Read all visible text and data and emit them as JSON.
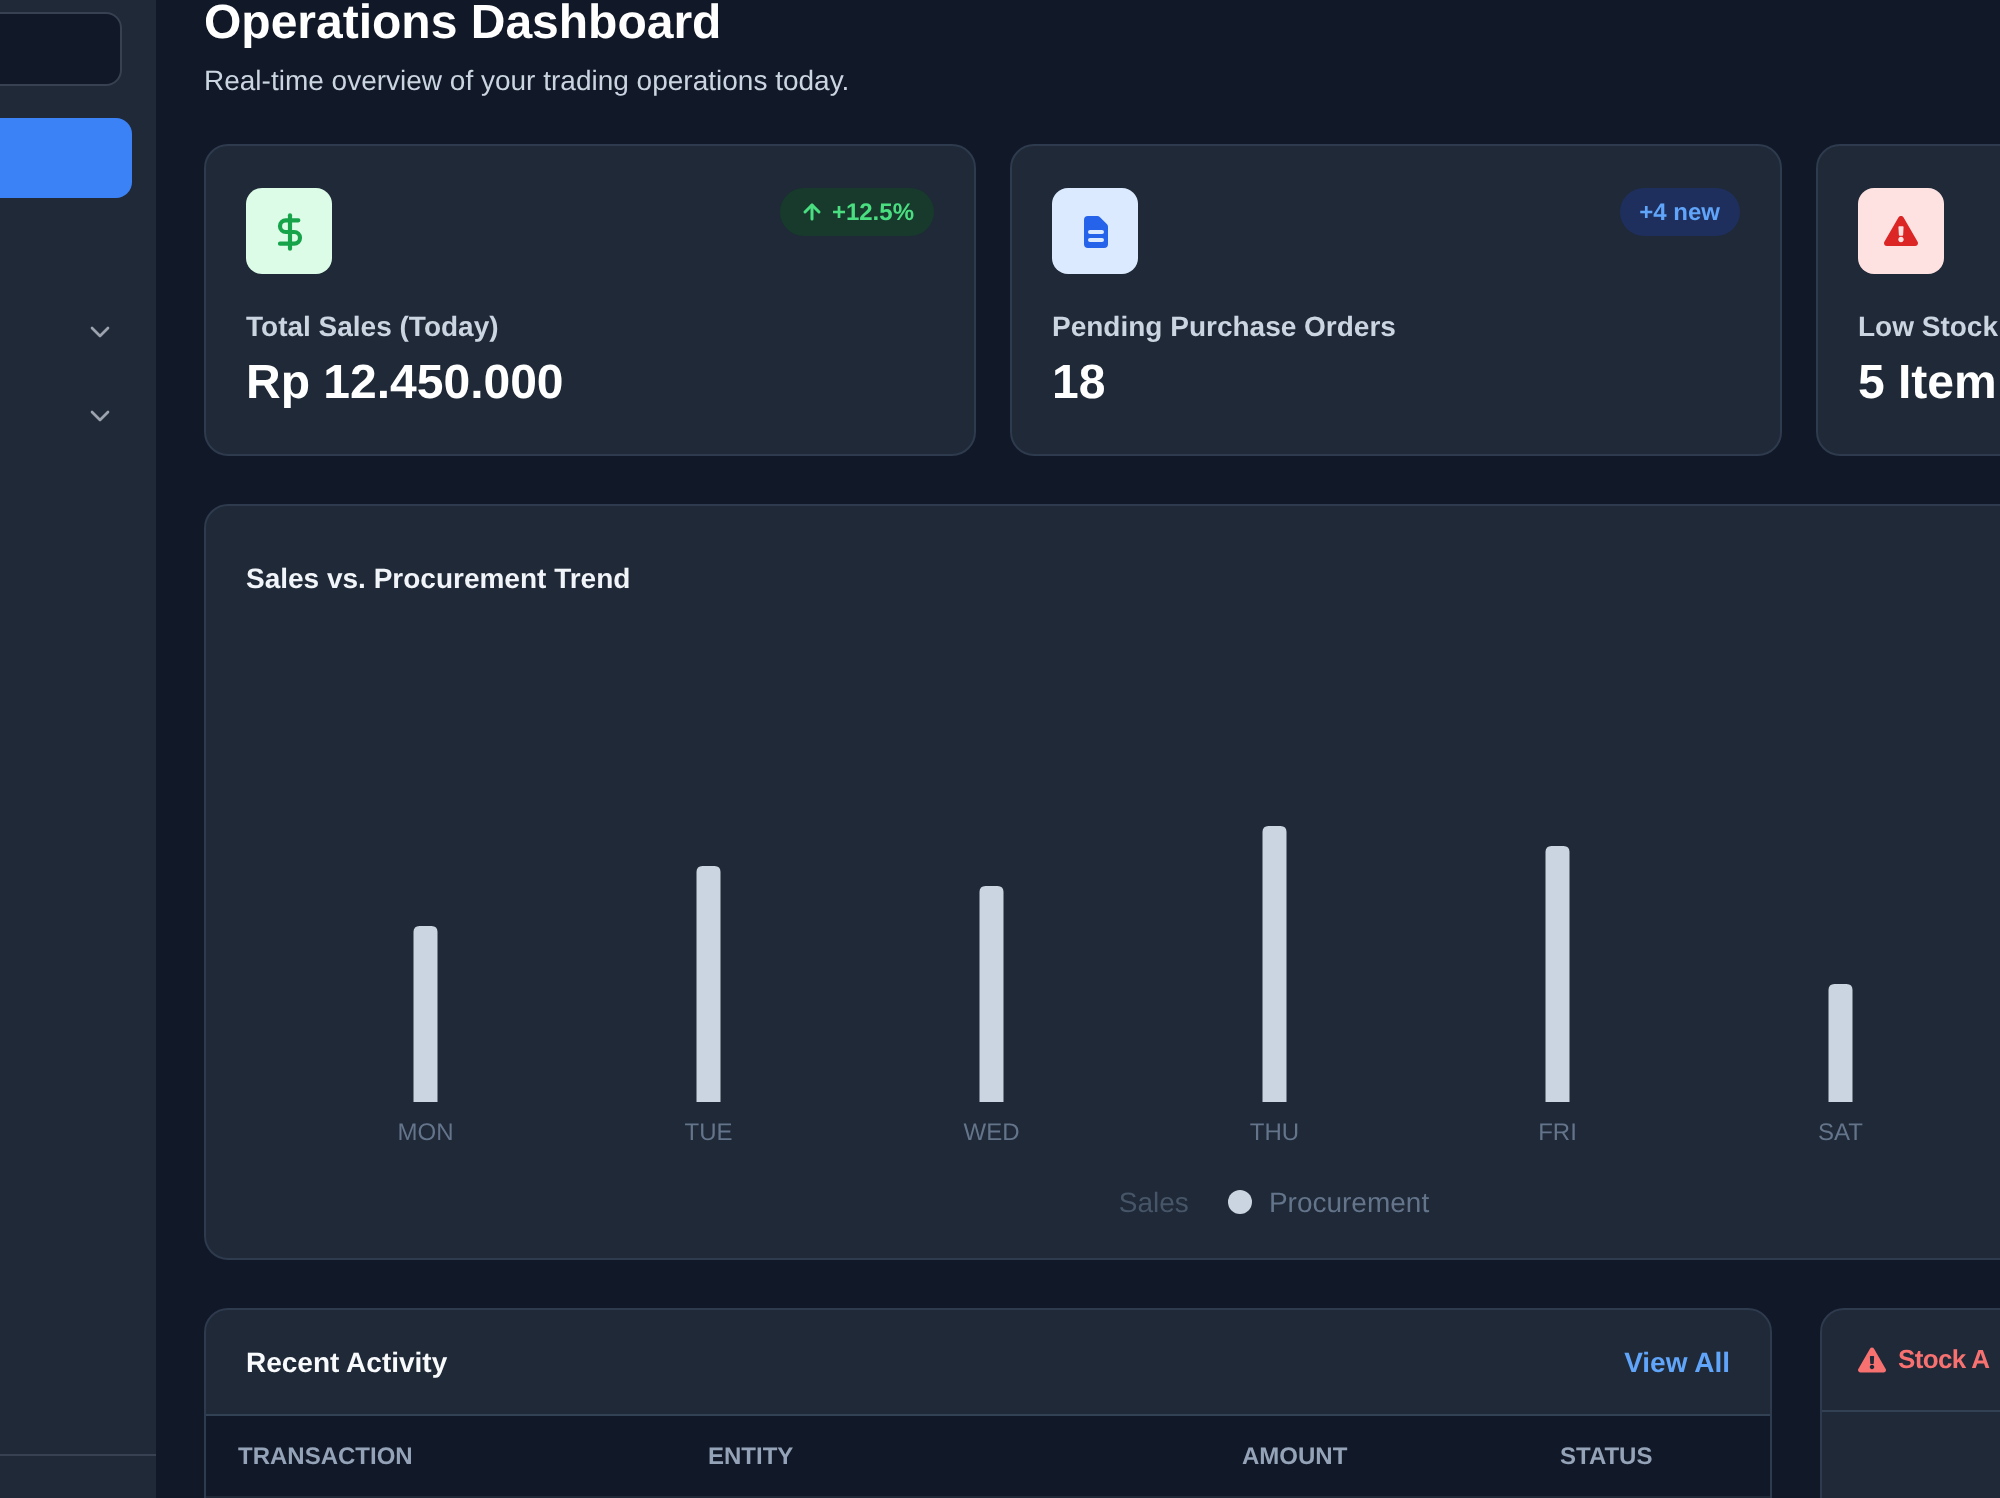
{
  "sidebar": {
    "nav": [
      {
        "kind": "link",
        "selected": true
      },
      {
        "kind": "group",
        "selected": false,
        "expanded": false
      },
      {
        "kind": "group",
        "selected": false,
        "expanded": false
      }
    ]
  },
  "header": {
    "title": "Operations Dashboard",
    "subtitle": "Real-time overview of your trading operations today."
  },
  "stat_cards": [
    {
      "kind": "sales",
      "label": "Total Sales (Today)",
      "value": "Rp 12.450.000",
      "badge": {
        "kind": "trend-up",
        "text": "+12.5%"
      }
    },
    {
      "kind": "orders",
      "label": "Pending Purchase Orders",
      "value": "18",
      "badge": {
        "kind": "info",
        "text": "+4 new"
      }
    },
    {
      "kind": "alert",
      "label": "Low Stock",
      "value": "5 Item"
    }
  ],
  "trend_chart": {
    "title": "Sales vs. Procurement Trend",
    "x_labels": [
      "MON",
      "TUE",
      "WED",
      "THU",
      "FRI",
      "SAT"
    ],
    "legend": [
      {
        "label": "Sales",
        "hidden": true
      },
      {
        "label": "Procurement",
        "hidden": false,
        "color": "#cbd5e1"
      }
    ]
  },
  "recent_activity": {
    "title": "Recent Activity",
    "link": "View All",
    "table": {
      "columns": [
        "TRANSACTION",
        "ENTITY",
        "AMOUNT",
        "STATUS"
      ]
    }
  },
  "stock_alerts": {
    "title": "Stock A"
  }
}
